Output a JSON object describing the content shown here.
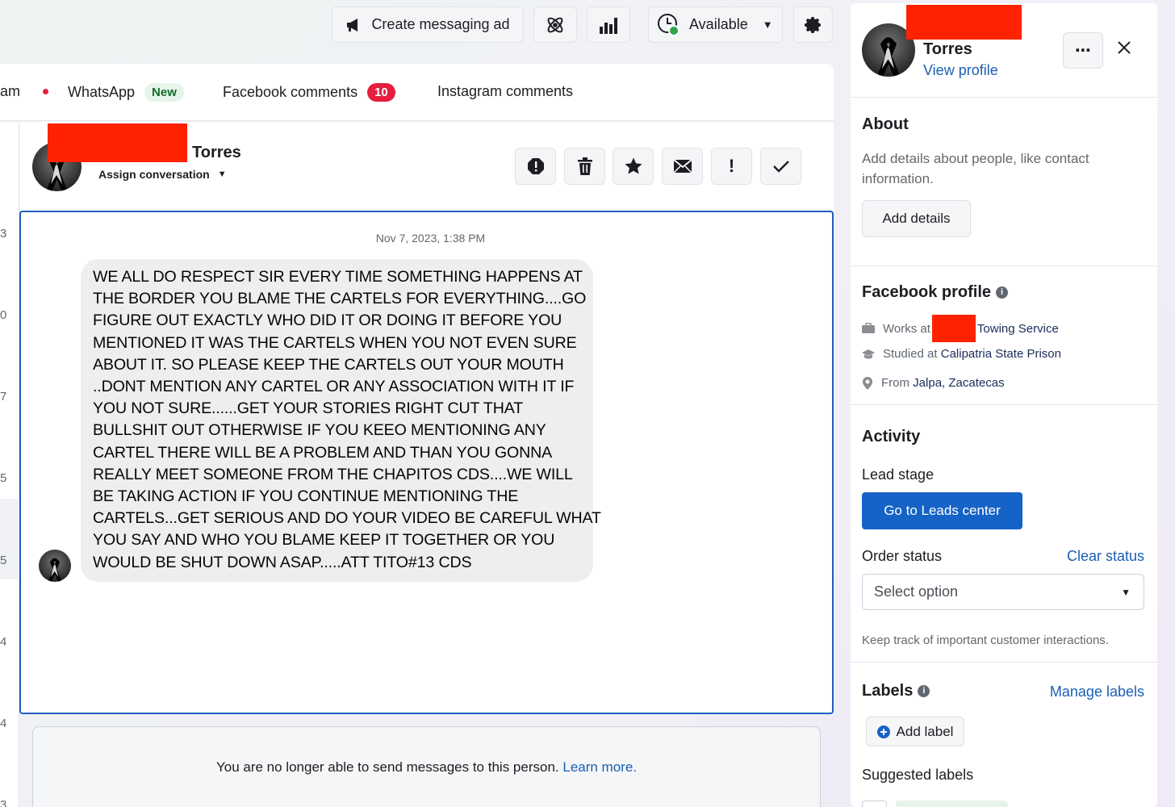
{
  "toolbar": {
    "create_ad_label": "Create messaging ad",
    "status_label": "Available"
  },
  "tabs": {
    "partial_label": "am",
    "whatsapp_label": "WhatsApp",
    "whatsapp_badge": "New",
    "fb_comments_label": "Facebook comments",
    "fb_comments_count": "10",
    "ig_comments_label": "Instagram comments"
  },
  "strip_numbers": [
    "3",
    "0",
    "7",
    "5",
    "5",
    "4",
    "4",
    "3"
  ],
  "conversation": {
    "name": "Torres",
    "assign_label": "Assign conversation",
    "timestamp": "Nov 7, 2023, 1:38 PM",
    "message_lines": [
      "WE ALL DO RESPECT SIR EVERY TIME SOMETHING HAPPENS AT",
      "THE BORDER YOU BLAME THE CARTELS FOR EVERYTHING....GO",
      "FIGURE OUT EXACTLY WHO DID IT OR DOING IT BEFORE YOU",
      "MENTIONED IT WAS THE CARTELS WHEN YOU NOT EVEN SURE",
      "ABOUT IT. SO PLEASE KEEP THE CARTELS OUT YOUR MOUTH",
      "..DONT MENTION ANY CARTEL OR ANY ASSOCIATION WITH IT IF",
      "YOU NOT SURE......GET YOUR STORIES RIGHT CUT THAT",
      "BULLSHIT OUT OTHERWISE IF YOU KEEO MENTIONING ANY",
      "CARTEL THERE WILL BE A PROBLEM AND THAN YOU GONNA",
      "REALLY MEET SOMEONE FROM THE CHAPITOS CDS....WE WILL",
      "BE TAKING  ACTION IF YOU CONTINUE MENTIONING THE",
      "CARTELS...GET SERIOUS AND DO YOUR VIDEO BE CAREFUL WHAT",
      "YOU SAY AND  WHO YOU BLAME KEEP IT TOGETHER OR YOU",
      "WOULD BE SHUT DOWN ASAP.....ATT TITO#13 CDS"
    ],
    "notice_text": "You are no longer able to send messages to this person.",
    "notice_link": "Learn more."
  },
  "sidebar": {
    "name": "Torres",
    "view_profile": "View profile",
    "about": {
      "heading": "About",
      "description": "Add details about people, like contact information.",
      "add_details": "Add details"
    },
    "fb_profile": {
      "heading": "Facebook profile",
      "works_prefix": "Works at",
      "works_value": "Towing Service",
      "studied_prefix": "Studied at",
      "studied_value": "Calipatria State Prison",
      "from_prefix": "From",
      "from_value": "Jalpa, Zacatecas"
    },
    "activity": {
      "heading": "Activity",
      "lead_stage": "Lead stage",
      "leads_button": "Go to Leads center",
      "order_status": "Order status",
      "clear_status": "Clear status",
      "select_placeholder": "Select option",
      "helper": "Keep track of important customer interactions."
    },
    "labels": {
      "heading": "Labels",
      "manage": "Manage labels",
      "add_label": "Add label",
      "suggested": "Suggested labels"
    }
  }
}
